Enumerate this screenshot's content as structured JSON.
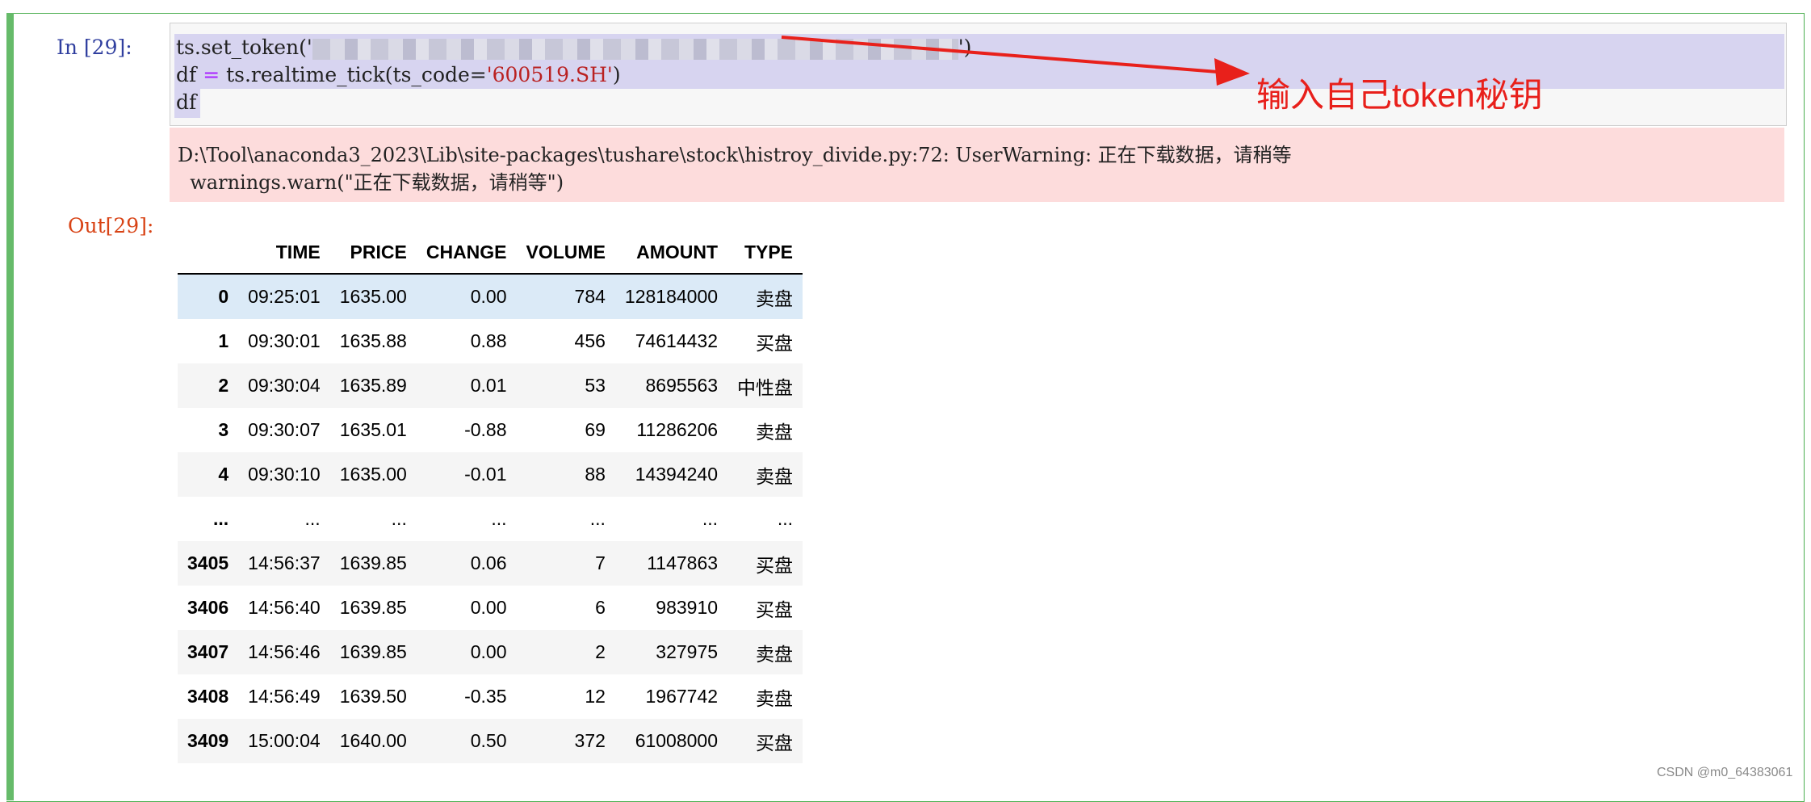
{
  "cell": {
    "in_prompt": "In  [29]:",
    "out_prompt": "Out[29]:",
    "code": {
      "line1_prefix": "ts.set_token('",
      "line1_suffix": "')",
      "line2_prefix": "df ",
      "line2_op": "=",
      "line2_mid": " ts.realtime_tick(ts_code=",
      "line2_str": "'600519.SH'",
      "line2_end": ")",
      "line3": "df"
    },
    "warning": {
      "line1": "D:\\Tool\\anaconda3_2023\\Lib\\site-packages\\tushare\\stock\\histroy_divide.py:72: UserWarning: 正在下载数据，请稍等",
      "line2": "  warnings.warn(\"正在下载数据，请稍等\")"
    }
  },
  "annotation": {
    "label": "输入自己token秘钥",
    "color": "#e8201b"
  },
  "table": {
    "columns": [
      "TIME",
      "PRICE",
      "CHANGE",
      "VOLUME",
      "AMOUNT",
      "TYPE"
    ],
    "rows": [
      {
        "index": "0",
        "cells": [
          "09:25:01",
          "1635.00",
          "0.00",
          "784",
          "128184000",
          "卖盘"
        ]
      },
      {
        "index": "1",
        "cells": [
          "09:30:01",
          "1635.88",
          "0.88",
          "456",
          "74614432",
          "买盘"
        ]
      },
      {
        "index": "2",
        "cells": [
          "09:30:04",
          "1635.89",
          "0.01",
          "53",
          "8695563",
          "中性盘"
        ]
      },
      {
        "index": "3",
        "cells": [
          "09:30:07",
          "1635.01",
          "-0.88",
          "69",
          "11286206",
          "卖盘"
        ]
      },
      {
        "index": "4",
        "cells": [
          "09:30:10",
          "1635.00",
          "-0.01",
          "88",
          "14394240",
          "卖盘"
        ]
      },
      {
        "index": "...",
        "cells": [
          "...",
          "...",
          "...",
          "...",
          "...",
          "..."
        ]
      },
      {
        "index": "3405",
        "cells": [
          "14:56:37",
          "1639.85",
          "0.06",
          "7",
          "1147863",
          "买盘"
        ]
      },
      {
        "index": "3406",
        "cells": [
          "14:56:40",
          "1639.85",
          "0.00",
          "6",
          "983910",
          "买盘"
        ]
      },
      {
        "index": "3407",
        "cells": [
          "14:56:46",
          "1639.85",
          "0.00",
          "2",
          "327975",
          "卖盘"
        ]
      },
      {
        "index": "3408",
        "cells": [
          "14:56:49",
          "1639.50",
          "-0.35",
          "12",
          "1967742",
          "卖盘"
        ]
      },
      {
        "index": "3409",
        "cells": [
          "15:00:04",
          "1640.00",
          "0.50",
          "372",
          "61008000",
          "买盘"
        ]
      }
    ]
  },
  "watermark": "CSDN @m0_64383061"
}
